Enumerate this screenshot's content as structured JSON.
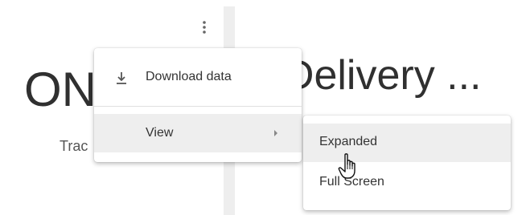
{
  "left_card": {
    "title": "ON-",
    "subtitle": "Trac"
  },
  "right_card": {
    "title": "t Delivery ..."
  },
  "menu": {
    "items": [
      {
        "label": "Download data",
        "icon": "download-icon"
      },
      {
        "label": "View",
        "icon": "chevron-right-icon"
      }
    ]
  },
  "submenu": {
    "items": [
      {
        "label": "Expanded"
      },
      {
        "label": "Full Screen"
      }
    ]
  },
  "colors": {
    "hover_background": "#eeeeee",
    "text": "#333333",
    "divider": "#eeeeee"
  }
}
